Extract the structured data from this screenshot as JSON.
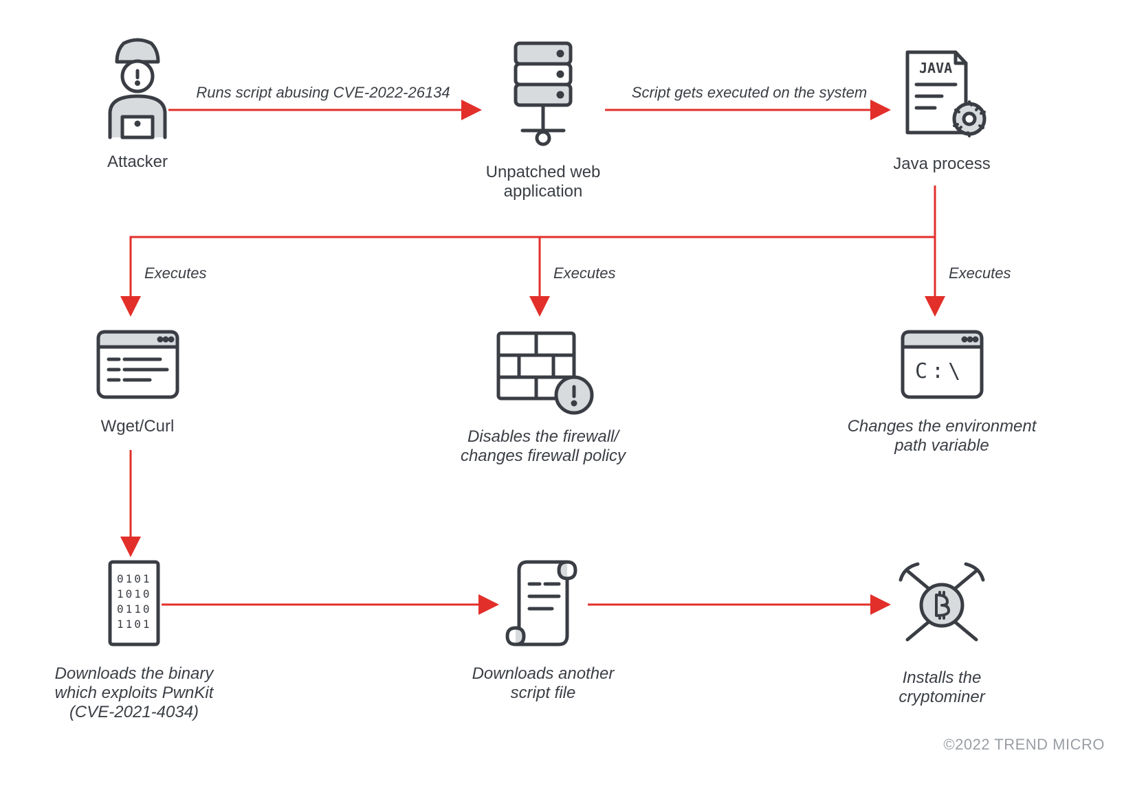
{
  "nodes": {
    "attacker": "Attacker",
    "webapp": "Unpatched web application",
    "java": "Java process",
    "wget": "Wget/Curl",
    "firewall": "Disables the firewall/\nchanges firewall policy",
    "envpath": "Changes the environment\npath variable",
    "binary": "Downloads the binary\nwhich exploits PwnKit\n(CVE-2021-4034)",
    "script": "Downloads another\nscript file",
    "crypto": "Installs the\ncryptominer"
  },
  "edges": {
    "a_to_web": "Runs script abusing CVE-2022-26134",
    "web_to_java": "Script gets executed on the system",
    "exec1": "Executes",
    "exec2": "Executes",
    "exec3": "Executes"
  },
  "copyright": "©2022 TREND MICRO",
  "colors": {
    "arrow": "#e22f2a",
    "iconStroke": "#3a3e44",
    "iconFill": "#d7dbde"
  }
}
